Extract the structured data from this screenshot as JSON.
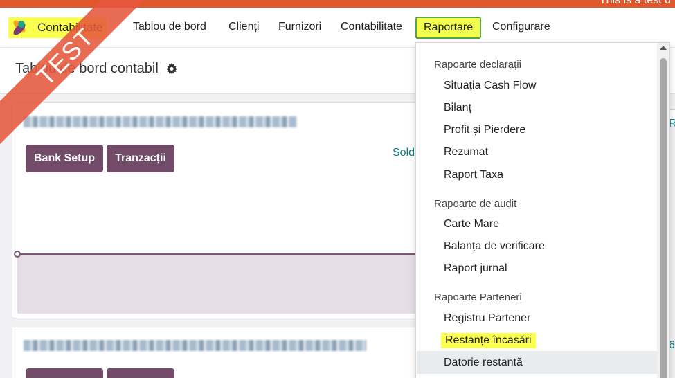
{
  "banner": {
    "text": "This is a test d"
  },
  "ribbon": {
    "text": "TEST"
  },
  "navbar": {
    "app_name": "Contabilitate",
    "items": [
      "Tablou de bord",
      "Clienți",
      "Furnizori",
      "Contabilitate",
      "Raportare",
      "Configurare"
    ],
    "active_item": "Raportare"
  },
  "page": {
    "title": "Tablou de bord contabil"
  },
  "cards": {
    "card1": {
      "buttons": [
        "Bank Setup",
        "Tranzacții"
      ],
      "balance_label": "Sold"
    }
  },
  "dropdown": {
    "sections": [
      {
        "title": "Rapoarte declarații",
        "items": [
          "Situația Cash Flow",
          "Bilanț",
          "Profit și Pierdere",
          "Rezumat",
          "Raport Taxa"
        ]
      },
      {
        "title": "Rapoarte de audit",
        "items": [
          "Carte Mare",
          "Balanța de verificare",
          "Raport jurnal"
        ]
      },
      {
        "title": "Rapoarte Parteneri",
        "items": [
          "Registru Partener",
          "Restanțe încasări",
          "Datorie restantă"
        ]
      }
    ],
    "highlighted_item": "Restanțe încasări",
    "hovered_item": "Datorie restantă"
  },
  "colors": {
    "primary": "#714b67",
    "highlight": "#fbff4e",
    "teal": "#017e84",
    "banner": "#e0572c"
  }
}
